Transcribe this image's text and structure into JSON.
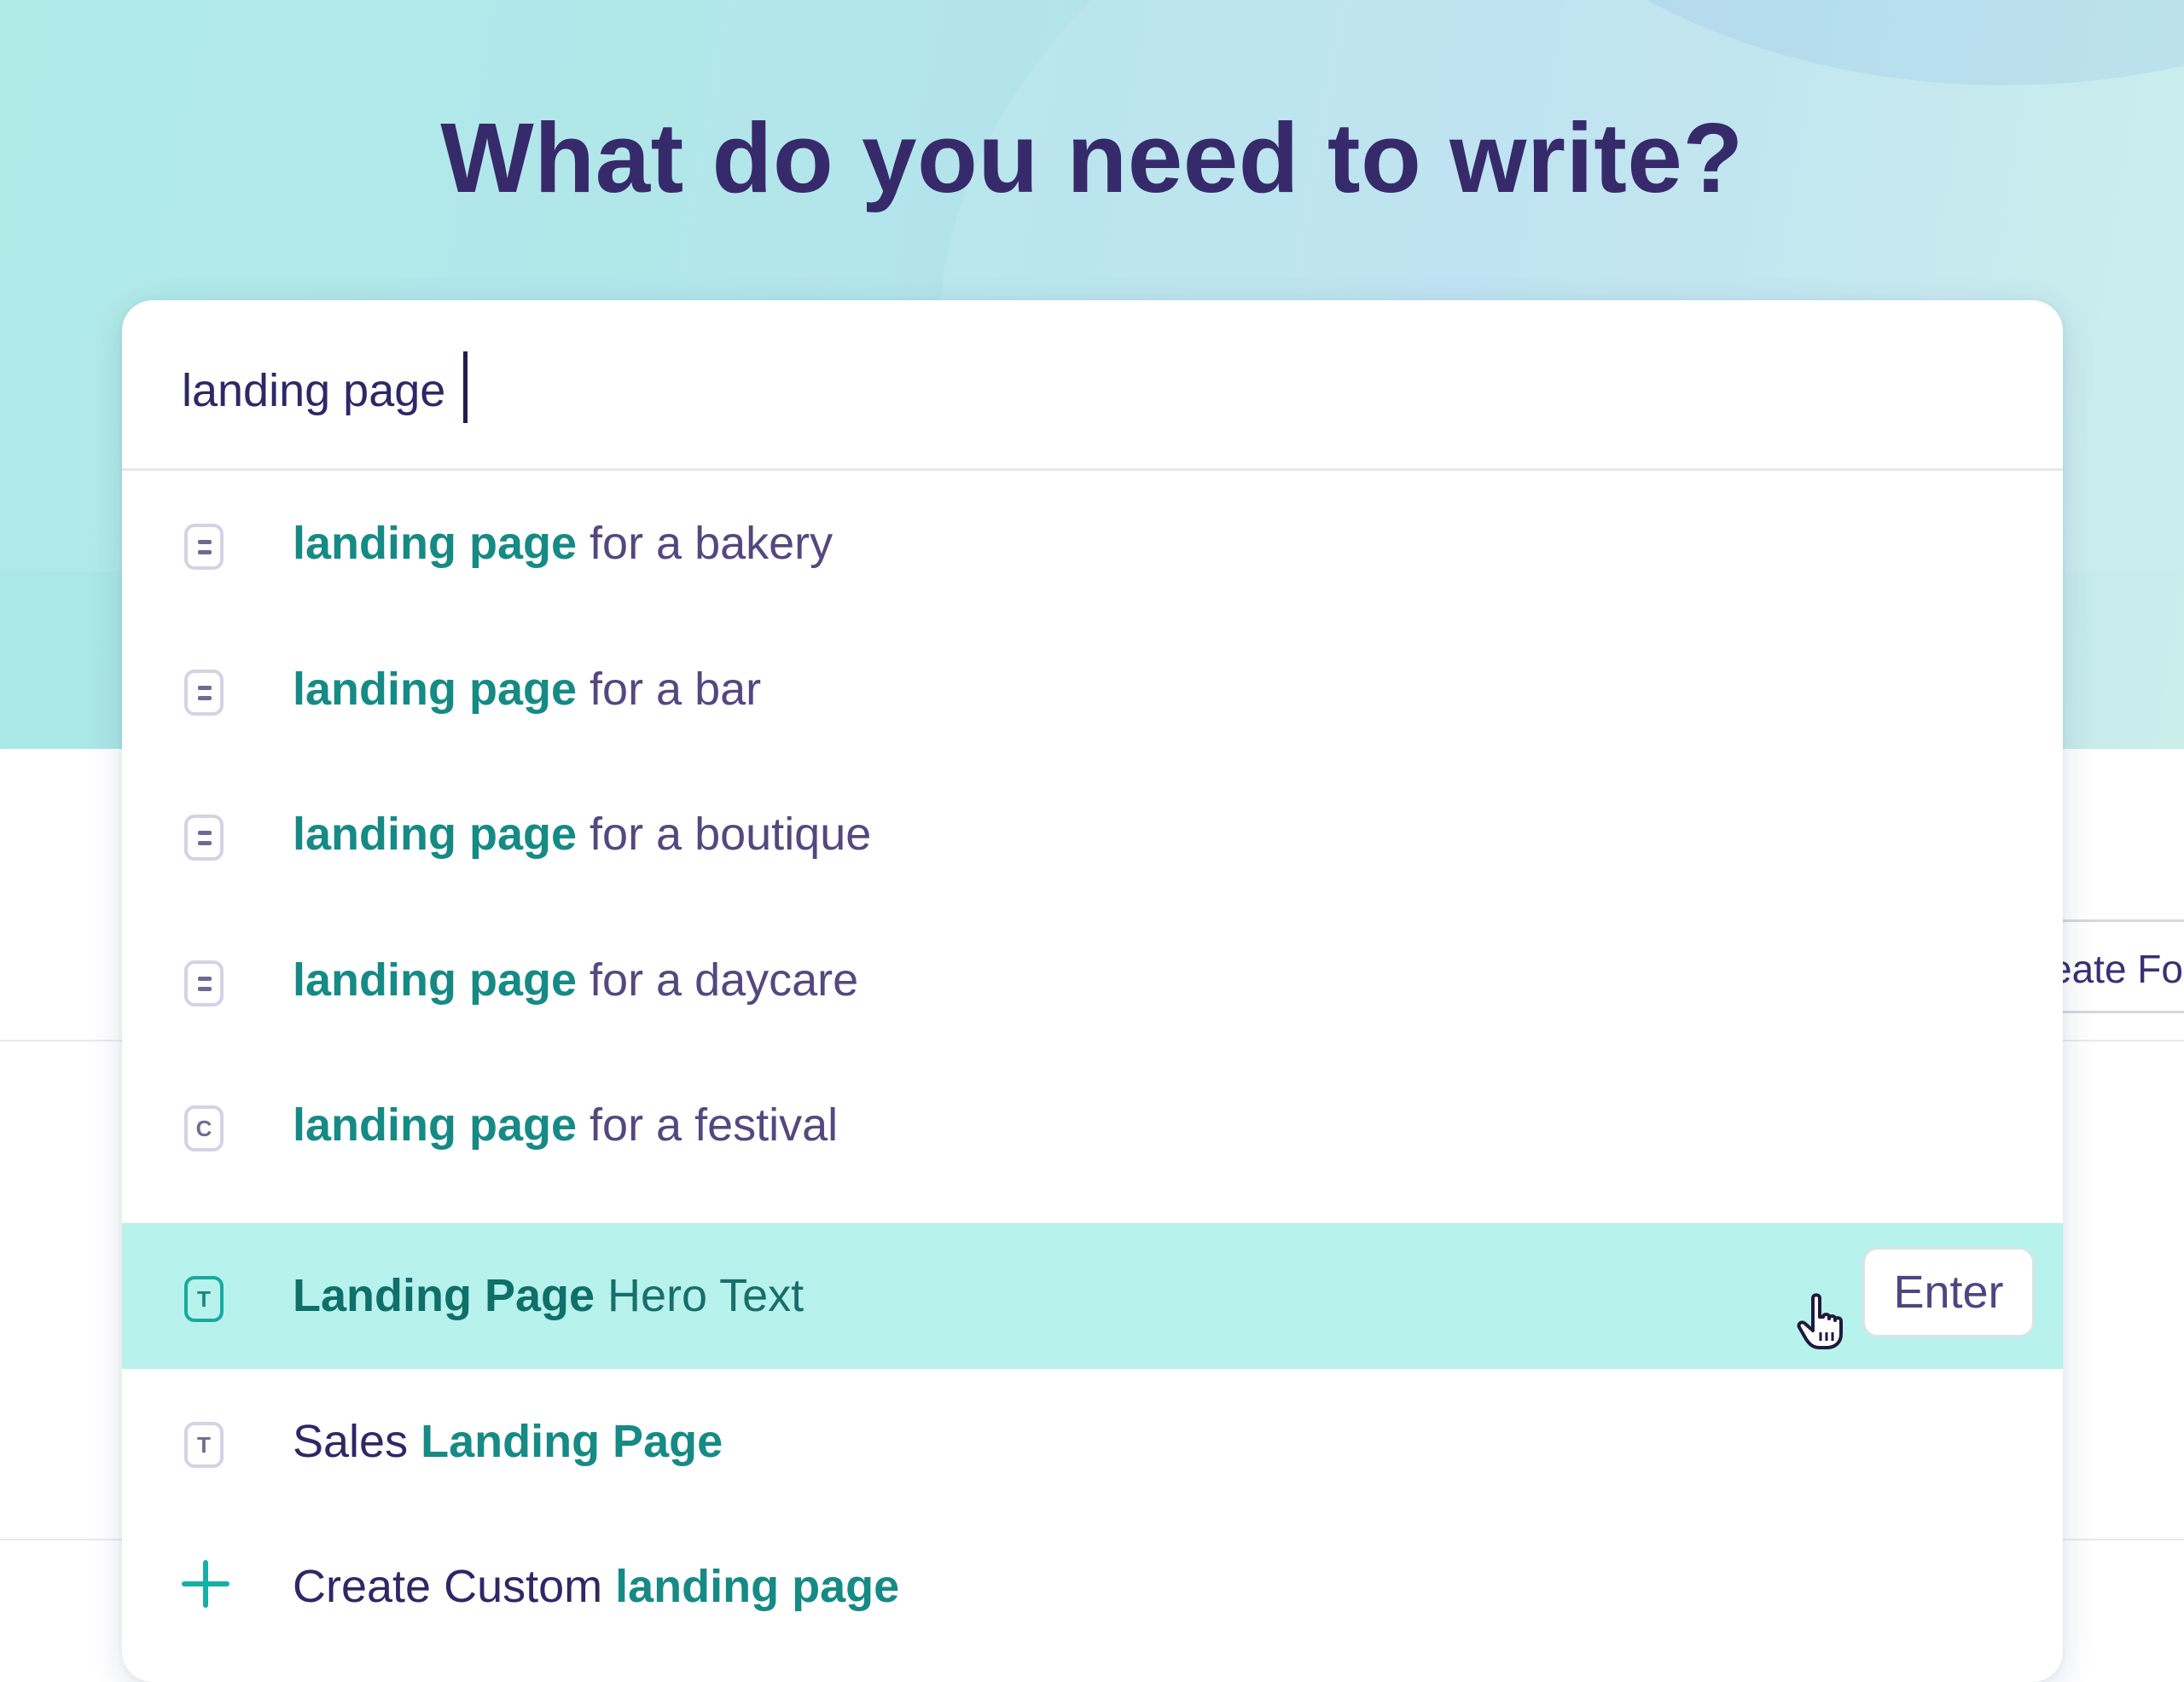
{
  "headline": "What do you need to write?",
  "search": {
    "value": "landing page",
    "placeholder": ""
  },
  "background": {
    "partial_button_label": "eate Fo"
  },
  "suggestions": [
    {
      "icon": "document-icon",
      "highlight": "landing page",
      "rest": " for a bakery"
    },
    {
      "icon": "document-icon",
      "highlight": "landing page",
      "rest": " for a bar"
    },
    {
      "icon": "document-icon",
      "highlight": "landing page",
      "rest": " for a boutique"
    },
    {
      "icon": "document-icon",
      "highlight": "landing page",
      "rest": " for a daycare"
    },
    {
      "icon": "c-template-icon",
      "icon_glyph": "C",
      "highlight": "landing page",
      "rest": " for a festival"
    },
    {
      "icon": "t-template-icon",
      "icon_glyph": "T",
      "highlight": "Landing Page",
      "rest": " Hero Text",
      "selected": true,
      "shortcut": "Enter"
    },
    {
      "icon": "t-template-icon",
      "icon_glyph": "T",
      "prefix": "Sales ",
      "highlight": "Landing Page"
    },
    {
      "icon": "plus-icon",
      "prefix": "Create Custom ",
      "highlight": "landing page"
    }
  ],
  "colors": {
    "headline": "#372a6b",
    "highlight": "#168a85",
    "selected_bg": "#b8f2ec",
    "plus_accent": "#14b0a6"
  }
}
